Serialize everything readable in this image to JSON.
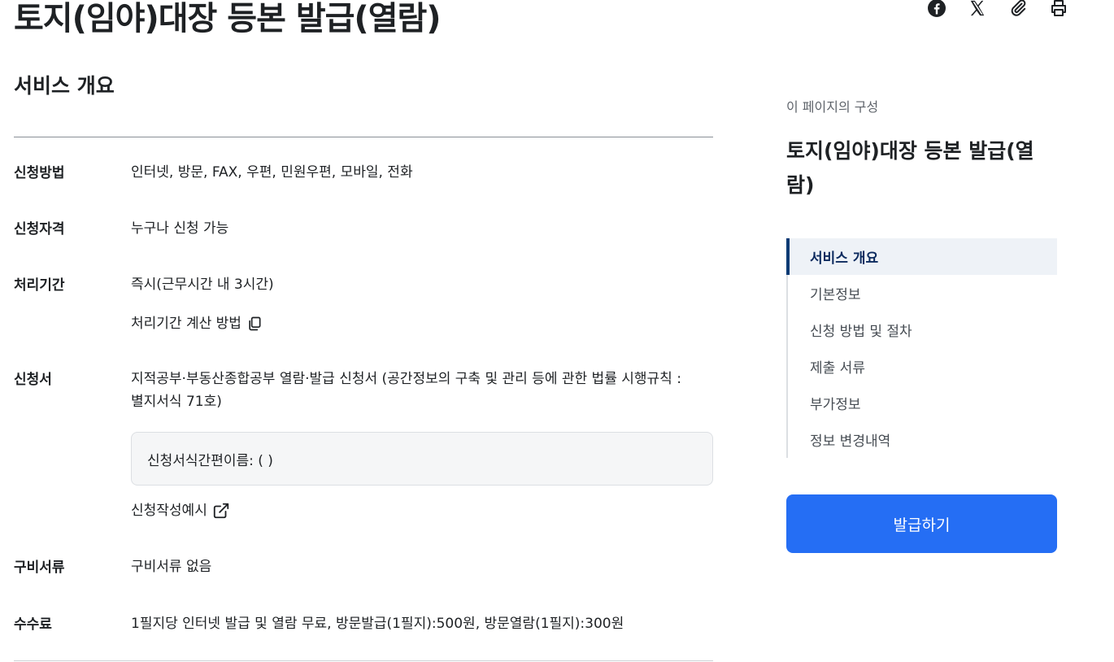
{
  "page": {
    "title": "토지(임야)대장 등본 발급(열람)"
  },
  "share_bar": {
    "icons": [
      "facebook-icon",
      "x-icon",
      "attachment-icon",
      "print-icon"
    ]
  },
  "overview": {
    "title": "서비스 개요",
    "rows": {
      "method": {
        "label": "신청방법",
        "value": "인터넷, 방문, FAX, 우편, 민원우편, 모바일, 전화"
      },
      "eligibility": {
        "label": "신청자격",
        "value": "누구나 신청 가능"
      },
      "period": {
        "label": "처리기간",
        "value": "즉시(근무시간 내 3시간)",
        "link": "처리기간 계산 방법"
      },
      "form": {
        "label": "신청서",
        "value_line1": "지적공부·부동산종합공부 열람·발급 신청서 (공간정보의 구축 및 관리 등에 관한 법률 시행규칙 :",
        "value_line2": "별지서식 71호)",
        "box_text": "신청서식간편이름: ( )",
        "link": "신청작성예시"
      },
      "documents": {
        "label": "구비서류",
        "value": "구비서류 없음"
      },
      "fee": {
        "label": "수수료",
        "value": "1필지당 인터넷 발급 및 열람 무료, 방문발급(1필지):500원, 방문열람(1필지):300원"
      }
    }
  },
  "toc": {
    "caption": "이 페이지의 구성",
    "title": "토지(임야)대장 등본 발급(열람)",
    "items": [
      {
        "label": "서비스 개요",
        "active": true
      },
      {
        "label": "기본정보"
      },
      {
        "label": "신청 방법 및 절차"
      },
      {
        "label": "제출 서류"
      },
      {
        "label": "부가정보"
      },
      {
        "label": "정보 변경내역"
      }
    ]
  },
  "action": {
    "issue_label": "발급하기"
  },
  "colors": {
    "primary": "#256ef4",
    "toc_active": "#0b3a74",
    "text": "#1e2124"
  }
}
